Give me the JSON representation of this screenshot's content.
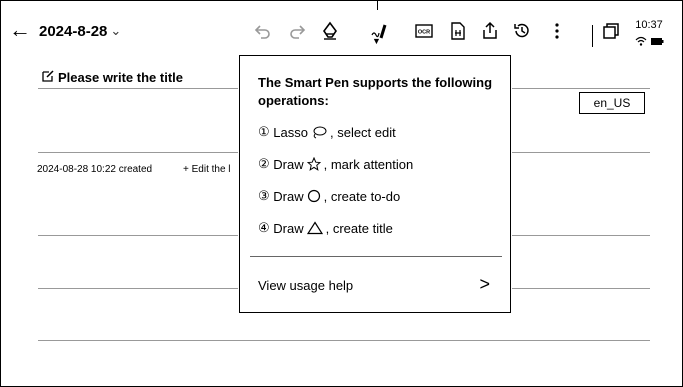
{
  "toolbar": {
    "back_glyph": "←",
    "date": "2024-8-28",
    "date_chevron": "⌄",
    "icons": [
      "undo-icon",
      "redo-icon",
      "eraser-icon",
      "smart-pen-icon",
      "ocr-icon",
      "layout-icon",
      "share-icon",
      "history-icon",
      "more-icon",
      "window-icon"
    ],
    "ocr_label": "OCR"
  },
  "status": {
    "time": "10:37",
    "icons": [
      "wifi-icon",
      "battery-icon"
    ]
  },
  "note": {
    "title_placeholder": "Please write the title",
    "language": "en_US",
    "created": "2024-08-28 10:22 created",
    "edit_link": "+ Edit the l"
  },
  "popup": {
    "heading": "The Smart Pen supports the following operations:",
    "operations": [
      {
        "num": "①",
        "pre": "Lasso",
        "post": ", select edit",
        "icon": "lasso-icon"
      },
      {
        "num": "②",
        "pre": "Draw",
        "post": ", mark attention",
        "icon": "star-icon"
      },
      {
        "num": "③",
        "pre": "Draw",
        "post": ", create to-do",
        "icon": "circle-icon"
      },
      {
        "num": "④",
        "pre": "Draw",
        "post": ", create title",
        "icon": "triangle-icon"
      }
    ],
    "help": "View usage help",
    "help_chevron": ">"
  }
}
